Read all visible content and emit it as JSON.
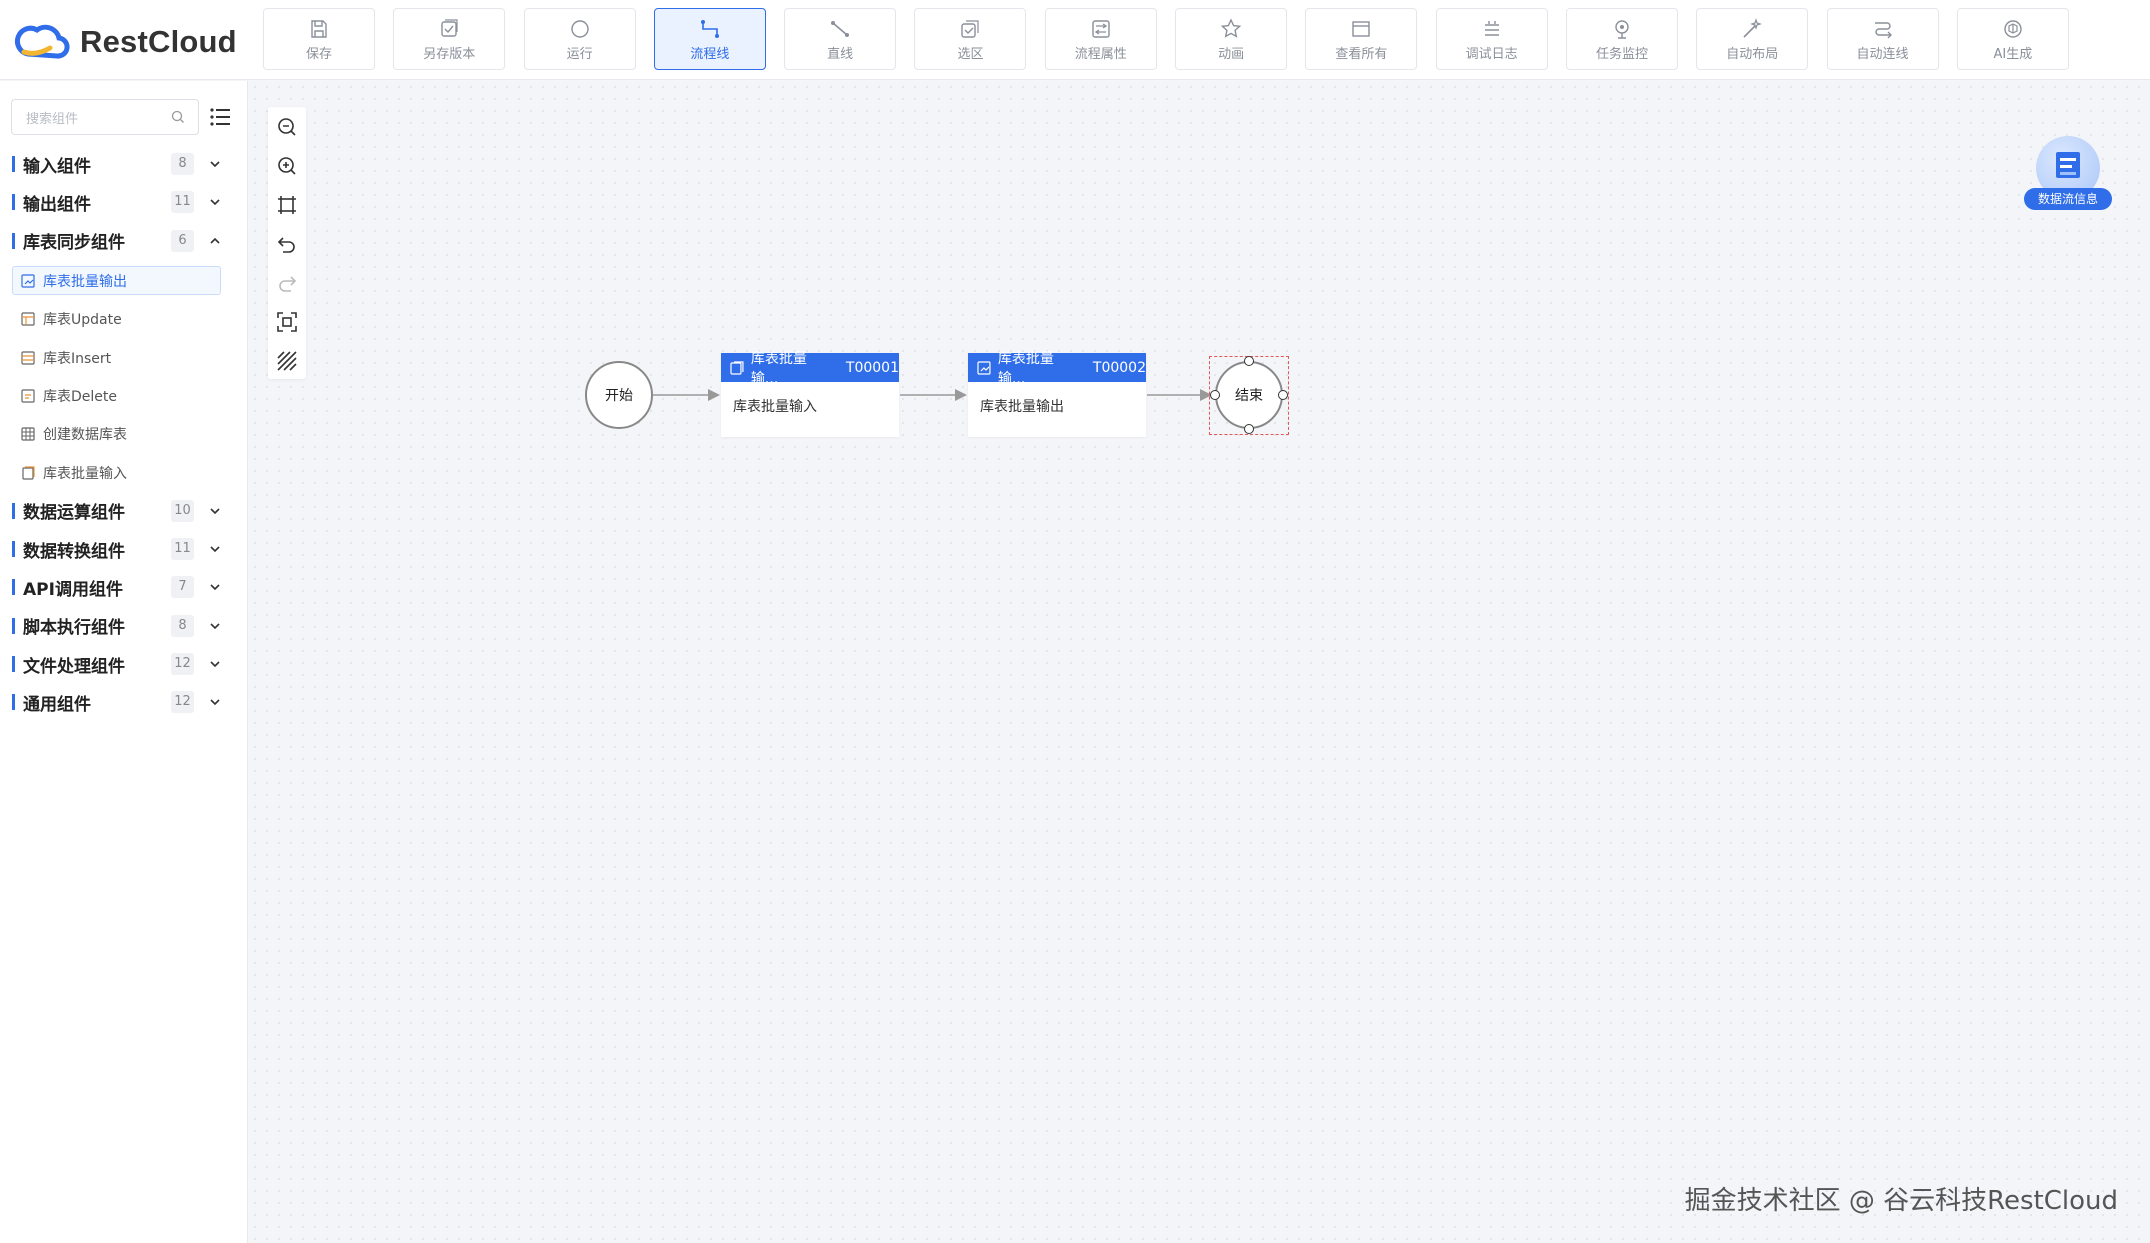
{
  "app": {
    "brand": "RestCloud"
  },
  "toolbar": {
    "buttons": [
      {
        "label": "保存",
        "icon": "save-icon"
      },
      {
        "label": "另存版本",
        "icon": "save-version-icon"
      },
      {
        "label": "运行",
        "icon": "run-icon"
      },
      {
        "label": "流程线",
        "icon": "flow-line-icon",
        "active": true
      },
      {
        "label": "直线",
        "icon": "straight-line-icon"
      },
      {
        "label": "选区",
        "icon": "select-area-icon"
      },
      {
        "label": "流程属性",
        "icon": "flow-properties-icon"
      },
      {
        "label": "动画",
        "icon": "animation-icon"
      },
      {
        "label": "查看所有",
        "icon": "view-all-icon"
      },
      {
        "label": "调试日志",
        "icon": "debug-log-icon"
      },
      {
        "label": "任务监控",
        "icon": "task-monitor-icon"
      },
      {
        "label": "自动布局",
        "icon": "auto-layout-icon"
      },
      {
        "label": "自动连线",
        "icon": "auto-connect-icon"
      },
      {
        "label": "AI生成",
        "icon": "ai-generate-icon"
      }
    ]
  },
  "sidebar": {
    "search_placeholder": "搜索组件",
    "groups": [
      {
        "title": "输入组件",
        "count": "8",
        "expanded": false
      },
      {
        "title": "输出组件",
        "count": "11",
        "expanded": false
      },
      {
        "title": "库表同步组件",
        "count": "6",
        "expanded": true,
        "items": [
          "库表批量输出",
          "库表Update",
          "库表Insert",
          "库表Delete",
          "创建数据库表",
          "库表批量输入"
        ],
        "selected_item": "库表批量输出"
      },
      {
        "title": "数据运算组件",
        "count": "10",
        "expanded": false
      },
      {
        "title": "数据转换组件",
        "count": "11",
        "expanded": false
      },
      {
        "title": "API调用组件",
        "count": "7",
        "expanded": false
      },
      {
        "title": "脚本执行组件",
        "count": "8",
        "expanded": false
      },
      {
        "title": "文件处理组件",
        "count": "12",
        "expanded": false
      },
      {
        "title": "通用组件",
        "count": "12",
        "expanded": false
      }
    ]
  },
  "flow": {
    "start_label": "开始",
    "end_label": "结束",
    "tasks": [
      {
        "title": "库表批量输...",
        "id": "T00001",
        "body": "库表批量输入"
      },
      {
        "title": "库表批量输...",
        "id": "T00002",
        "body": "库表批量输出"
      }
    ]
  },
  "dataflow_info_label": "数据流信息",
  "watermark": "掘金技术社区 @ 谷云科技RestCloud",
  "colors": {
    "accent": "#2f6ee8",
    "selection": "#e05858"
  }
}
